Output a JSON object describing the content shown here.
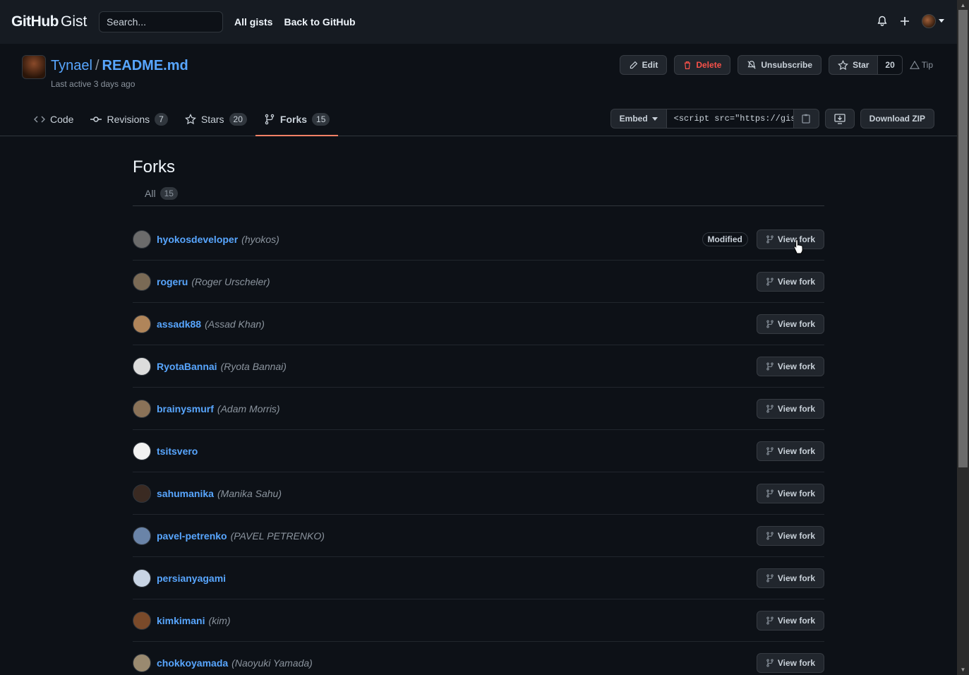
{
  "header": {
    "logo_main": "GitHub",
    "logo_sub": "Gist",
    "search_placeholder": "Search...",
    "nav": [
      "All gists",
      "Back to GitHub"
    ]
  },
  "gist": {
    "owner": "Tynael",
    "separator": "/",
    "filename": "README.md",
    "last_active": "Last active 3 days ago",
    "actions": {
      "edit": "Edit",
      "delete": "Delete",
      "unsubscribe": "Unsubscribe",
      "star": "Star",
      "star_count": "20",
      "tip": "Tip"
    },
    "tabs": [
      {
        "label": "Code",
        "count": null,
        "icon": "code-icon"
      },
      {
        "label": "Revisions",
        "count": "7",
        "icon": "commit-icon"
      },
      {
        "label": "Stars",
        "count": "20",
        "icon": "star-icon"
      },
      {
        "label": "Forks",
        "count": "15",
        "icon": "fork-icon",
        "active": true
      }
    ],
    "embed": {
      "label": "Embed",
      "value": "<script src=\"https://gist.github.com/Tynael/",
      "download": "Download ZIP"
    }
  },
  "forks_page": {
    "title": "Forks",
    "filter_label": "All",
    "filter_count": "15",
    "view_fork_label": "View fork",
    "modified_label": "Modified",
    "items": [
      {
        "username": "hyokosdeveloper",
        "name": "(hyokos)",
        "modified": true,
        "avatar_color": "#6b6b6b"
      },
      {
        "username": "rogeru",
        "name": "(Roger Urscheler)",
        "modified": false,
        "avatar_color": "#7a6a55"
      },
      {
        "username": "assadk88",
        "name": "(Assad Khan)",
        "modified": false,
        "avatar_color": "#b0855a"
      },
      {
        "username": "RyotaBannai",
        "name": "(Ryota Bannai)",
        "modified": false,
        "avatar_color": "#dcdcdc"
      },
      {
        "username": "brainysmurf",
        "name": "(Adam Morris)",
        "modified": false,
        "avatar_color": "#8a7258"
      },
      {
        "username": "tsitsvero",
        "name": "",
        "modified": false,
        "avatar_color": "#f2f2f2"
      },
      {
        "username": "sahumanika",
        "name": "(Manika Sahu)",
        "modified": false,
        "avatar_color": "#3a2a22"
      },
      {
        "username": "pavel-petrenko",
        "name": "(PAVEL PETRENKO)",
        "modified": false,
        "avatar_color": "#6a84a8"
      },
      {
        "username": "persianyagami",
        "name": "",
        "modified": false,
        "avatar_color": "#c8d4e4"
      },
      {
        "username": "kimkimani",
        "name": "(kim)",
        "modified": false,
        "avatar_color": "#7a4a2a"
      },
      {
        "username": "chokkoyamada",
        "name": "(Naoyuki Yamada)",
        "modified": false,
        "avatar_color": "#9a8a70"
      }
    ]
  }
}
